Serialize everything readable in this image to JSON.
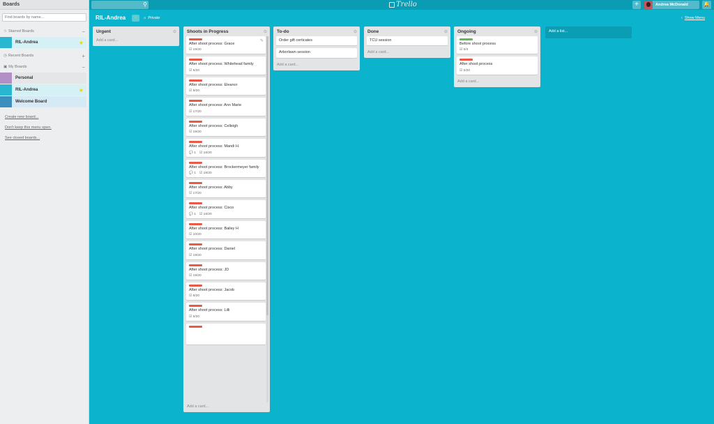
{
  "sidebar": {
    "title": "Boards",
    "search_placeholder": "Find boards by name...",
    "starred_label": "Starred Boards",
    "starred_ctl": "−",
    "starred": [
      {
        "name": "RIL-Andrea",
        "color": "#29b6d0",
        "starred": "★"
      }
    ],
    "recent_label": "Recent Boards",
    "recent_ctl": "+",
    "my_label": "My Boards",
    "my_ctl": "−",
    "my_boards": [
      {
        "name": "Personal",
        "color": "#b28fc4",
        "starred": ""
      },
      {
        "name": "RIL-Andrea",
        "color": "#29b6d0",
        "starred": "★"
      },
      {
        "name": "Welcome Board",
        "color": "#3c8ebf",
        "starred": ""
      }
    ],
    "links": [
      "Create new board...",
      "Don't keep this menu open.",
      "See closed boards..."
    ]
  },
  "topbar": {
    "search_icon": "⚲",
    "logo": "Trello",
    "add_icon": "+",
    "user_name": "Andrea McDonald",
    "bell_icon": "🔔"
  },
  "board": {
    "title": "RIL-Andrea",
    "star_icon": "☆",
    "privacy_icon": "⌂",
    "privacy": "Private",
    "show_menu_icon": "‹",
    "show_menu": "Show Menu"
  },
  "colors": {
    "label_red": "#eb5a46",
    "label_green": "#61bd4f",
    "background": "#0cb3cc"
  },
  "lists": {
    "urgent": {
      "name": "Urgent",
      "menu_icon": "⊝",
      "add": "Add a card..."
    },
    "shoots": {
      "name": "Shoots in Progress",
      "menu_icon": "⊝",
      "add": "Add a card...",
      "cards": [
        {
          "title": "After shoot process: Grace",
          "checklist": "19/20",
          "comments": "",
          "edit": "✎"
        },
        {
          "title": "After shoot process: Whitehead family",
          "checklist": "6/20",
          "comments": ""
        },
        {
          "title": "After shoot process: Eleanor",
          "checklist": "9/20",
          "comments": ""
        },
        {
          "title": "After shoot process: Ann Marie",
          "checklist": "17/20",
          "comments": ""
        },
        {
          "title": "After shoot process: Celleigh",
          "checklist": "19/20",
          "comments": ""
        },
        {
          "title": "After shoot process: Mandi H.",
          "checklist": "18/20",
          "comments": "1"
        },
        {
          "title": "After shoot process: Brockermeyer family",
          "checklist": "18/20",
          "comments": "1"
        },
        {
          "title": "After shoot process: Abby",
          "checklist": "17/20",
          "comments": ""
        },
        {
          "title": "After shoot process: Cisco",
          "checklist": "18/20",
          "comments": "1"
        },
        {
          "title": "After shoot process: Bailey H",
          "checklist": "10/20",
          "comments": ""
        },
        {
          "title": "After shoot process: Daniel",
          "checklist": "19/20",
          "comments": ""
        },
        {
          "title": "After shoot process: JD",
          "checklist": "19/20",
          "comments": ""
        },
        {
          "title": "After shoot process: Jacob",
          "checklist": "8/20",
          "comments": ""
        },
        {
          "title": "After shoot process: Lilli",
          "checklist": "5/20",
          "comments": ""
        },
        {
          "title": "",
          "checklist": "",
          "comments": ""
        }
      ]
    },
    "todo": {
      "name": "To-do",
      "menu_icon": "⊝",
      "add": "Add a card...",
      "cards": [
        {
          "title": "Order gift certicates"
        },
        {
          "title": "Arborlawn session"
        }
      ]
    },
    "done": {
      "name": "Done",
      "menu_icon": "⊝",
      "add": "Add a card...",
      "cards": [
        {
          "title": "TCU session"
        }
      ]
    },
    "ongoing": {
      "name": "Ongoing",
      "menu_icon": "⊝",
      "add": "Add a card...",
      "cards": [
        {
          "title": "Before shoot process",
          "checklist": "0/4",
          "label": "green"
        },
        {
          "title": "After shoot process",
          "checklist": "0/20",
          "label": "red"
        }
      ]
    },
    "add_list": "Add a list..."
  }
}
